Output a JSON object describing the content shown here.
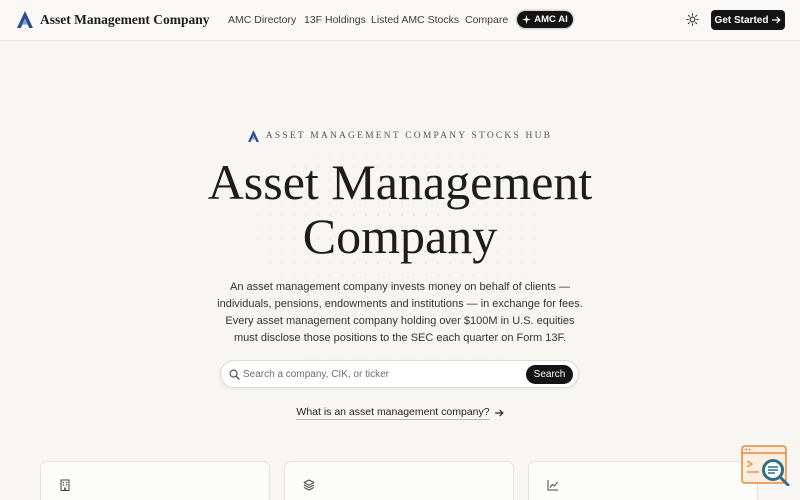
{
  "nav": {
    "brand": "Asset Management Company",
    "links": [
      "AMC Directory",
      "13F Holdings",
      "Listed AMC Stocks",
      "Compare"
    ],
    "ai_label": "AMC AI",
    "cta_label": "Get Started"
  },
  "hero": {
    "eyebrow": "ASSET MANAGEMENT COMPANY STOCKS HUB",
    "title_line1": "Asset Management",
    "title_line2": "Company",
    "desc_line1": "An asset management company invests money on behalf of clients —",
    "desc_line2": "individuals, pensions, endowments and institutions — in exchange for fees.",
    "desc_line3": "Every asset management company holding over $100M in U.S. equities",
    "desc_line4": "must disclose those positions to the SEC each quarter on Form 13F."
  },
  "search": {
    "placeholder": "Search a company, CIK, or ticker",
    "button_label": "Search"
  },
  "learn_link": "What is an asset management company?",
  "cards": [
    {
      "icon": "building-icon"
    },
    {
      "icon": "layers-icon"
    },
    {
      "icon": "chart-line-icon"
    }
  ],
  "colors": {
    "background": "#f7f6f3",
    "dark": "#141414",
    "logo_accent": "#2b4d8c"
  }
}
